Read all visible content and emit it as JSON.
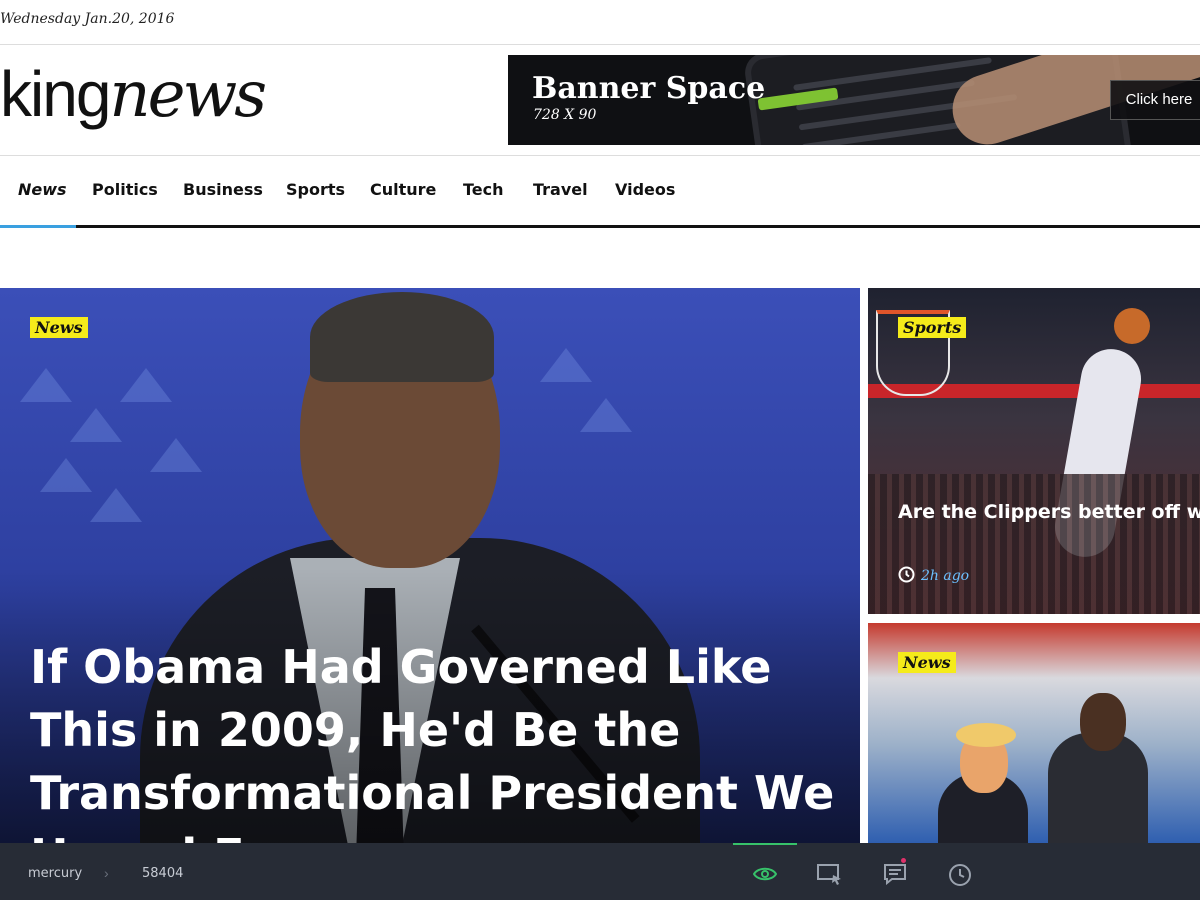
{
  "topbar": {
    "date": "Wednesday Jan.20, 2016"
  },
  "header": {
    "logo_part1": "king",
    "logo_part2": "news",
    "banner": {
      "title": "Banner Space",
      "subtitle": "728 X 90",
      "cta": "Click here"
    }
  },
  "nav": {
    "items": [
      {
        "label": "News"
      },
      {
        "label": "Politics"
      },
      {
        "label": "Business"
      },
      {
        "label": "Sports"
      },
      {
        "label": "Culture"
      },
      {
        "label": "Tech"
      },
      {
        "label": "Travel"
      },
      {
        "label": "Videos"
      }
    ],
    "active_index": 0,
    "accent_color": "#3aa0e0"
  },
  "hero": {
    "tag": "News",
    "title": "If Obama Had Governed Like This in 2009, He'd Be the Transformational President We Hoped For"
  },
  "side": [
    {
      "tag": "Sports",
      "title": "Are the Clippers better off without Blake Griffin?",
      "time": "2h ago"
    },
    {
      "tag": "News"
    }
  ],
  "tag_color": "#f5eb1a",
  "bottombar": {
    "crumbs": [
      "mercury",
      "58404"
    ],
    "tools": [
      {
        "icon": "eye-icon",
        "active": true
      },
      {
        "icon": "screen-cursor-icon"
      },
      {
        "icon": "comment-icon",
        "badge": true
      },
      {
        "icon": "clock-icon"
      }
    ],
    "active_color": "#37c26a"
  }
}
